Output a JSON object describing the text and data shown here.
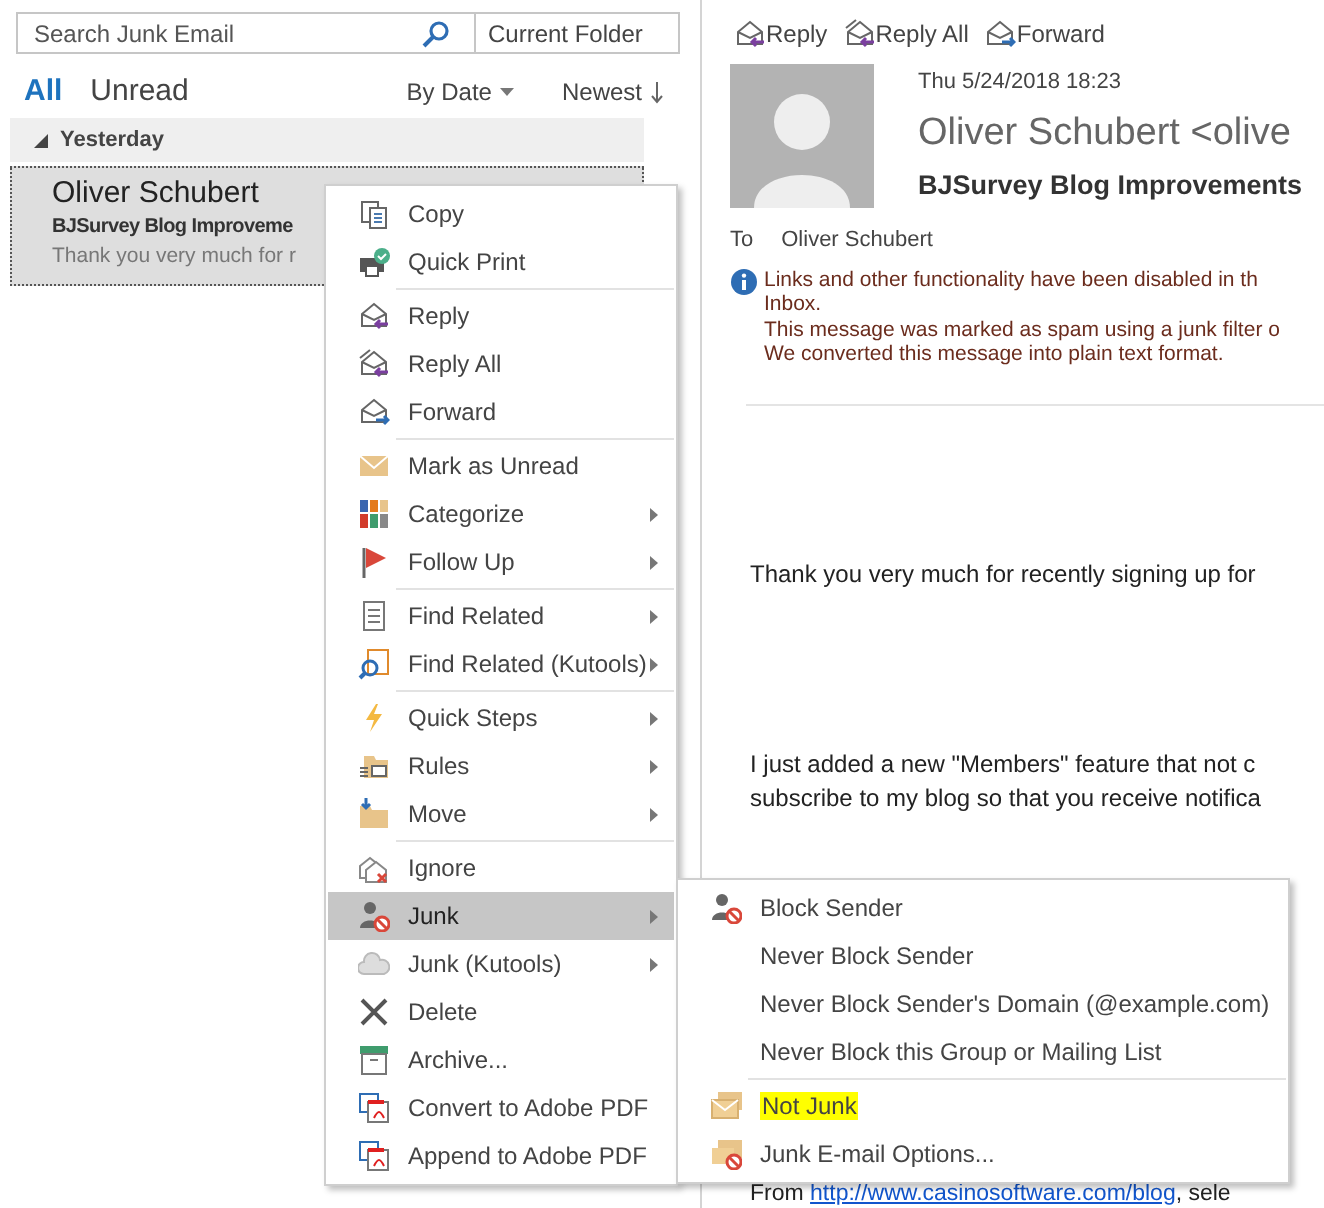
{
  "search": {
    "placeholder": "Search Junk Email",
    "scope": "Current Folder"
  },
  "filters": [
    {
      "label": "All",
      "selected": true
    },
    {
      "label": "Unread",
      "selected": false
    }
  ],
  "sort": {
    "by": "By Date",
    "order": "Newest"
  },
  "message_list": {
    "group": "Yesterday",
    "expanded": true,
    "messages": [
      {
        "sender": "Oliver Schubert",
        "subject": "BJSurvey Blog Improveme",
        "preview": "Thank you very much for r",
        "selected": true
      }
    ]
  },
  "reading_pane": {
    "actions": [
      "Reply",
      "Reply All",
      "Forward"
    ],
    "date": "Thu 5/24/2018 18:23",
    "sender": "Oliver Schubert <olive",
    "subject": "BJSurvey Blog Improvements",
    "to_label": "To",
    "to": "Oliver Schubert",
    "notices": [
      "Links and other functionality have been disabled in th",
      "Inbox.",
      "This message was marked as spam using a junk filter o",
      "We converted this message into plain text format."
    ],
    "body": [
      [
        "Thank you very much for recently signing up for"
      ],
      [
        "I just added a new \"Members\" feature that not c",
        "subscribe to my blog so that you receive notifica"
      ]
    ],
    "from_line": {
      "prefix": "From ",
      "link": "http://www.casinosoftware.com/blog",
      "suffix": ", sele"
    }
  },
  "context_menu": {
    "groups": [
      [
        {
          "label": "Copy",
          "submenu": false,
          "selected": false
        },
        {
          "label": "Quick Print",
          "submenu": false,
          "selected": false
        }
      ],
      [
        {
          "label": "Reply",
          "submenu": false,
          "selected": false
        },
        {
          "label": "Reply All",
          "submenu": false,
          "selected": false
        },
        {
          "label": "Forward",
          "submenu": false,
          "selected": false
        }
      ],
      [
        {
          "label": "Mark as Unread",
          "submenu": false,
          "selected": false
        },
        {
          "label": "Categorize",
          "submenu": true,
          "selected": false
        },
        {
          "label": "Follow Up",
          "submenu": true,
          "selected": false
        }
      ],
      [
        {
          "label": "Find Related",
          "submenu": true,
          "selected": false
        },
        {
          "label": "Find Related (Kutools)",
          "submenu": true,
          "selected": false
        }
      ],
      [
        {
          "label": "Quick Steps",
          "submenu": true,
          "selected": false
        },
        {
          "label": "Rules",
          "submenu": true,
          "selected": false
        },
        {
          "label": "Move",
          "submenu": true,
          "selected": false
        }
      ],
      [
        {
          "label": "Ignore",
          "submenu": false,
          "selected": false
        },
        {
          "label": "Junk",
          "submenu": true,
          "selected": true
        },
        {
          "label": "Junk (Kutools)",
          "submenu": true,
          "selected": false
        },
        {
          "label": "Delete",
          "submenu": false,
          "selected": false
        },
        {
          "label": "Archive...",
          "submenu": false,
          "selected": false
        },
        {
          "label": "Convert to Adobe PDF",
          "submenu": false,
          "selected": false
        },
        {
          "label": "Append to Adobe PDF",
          "submenu": false,
          "selected": false
        }
      ]
    ]
  },
  "junk_submenu": {
    "groups": [
      [
        {
          "label": "Block Sender",
          "highlighted": false
        },
        {
          "label": "Never Block Sender",
          "highlighted": false
        },
        {
          "label": "Never Block Sender's Domain (@example.com)",
          "highlighted": false
        },
        {
          "label": "Never Block this Group or Mailing List",
          "highlighted": false
        }
      ],
      [
        {
          "label": "Not Junk",
          "highlighted": true
        },
        {
          "label": "Junk E-mail Options...",
          "highlighted": false
        }
      ]
    ]
  }
}
